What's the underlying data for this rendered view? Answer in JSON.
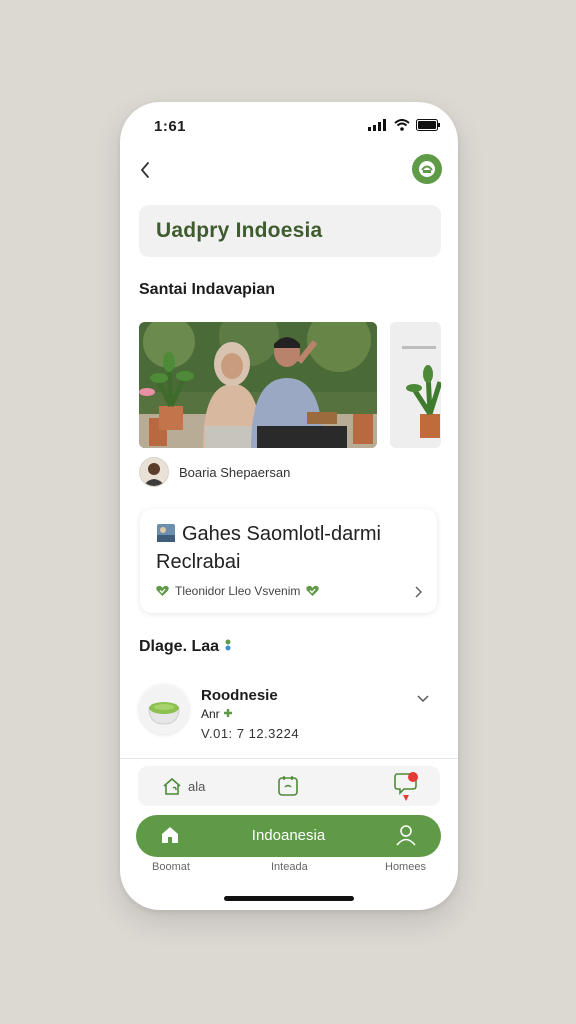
{
  "status_bar": {
    "time": "1:61"
  },
  "header": {
    "search_value": "Uadpry Indoesia"
  },
  "section": {
    "title": "Santai Indavapian",
    "author": "Boaria Shepaersan"
  },
  "card": {
    "title": "Gahes Saomlotl-darmi Reclrabai",
    "tag_text": "Tleonidor Lleo Vsvenim"
  },
  "list": {
    "title": "Dlage. Laa",
    "item": {
      "name": "Roodnesie",
      "sub": "Anr",
      "date": "V.01: 7 12.3224"
    }
  },
  "toolbar": {
    "home_label": "ala"
  },
  "bottom_nav": {
    "label": "Indoanesia",
    "captions": [
      "Boomat",
      "Inteada",
      "Homees"
    ]
  },
  "colors": {
    "accent": "#5f9a46",
    "alert": "#e53935"
  },
  "icons": [
    "back-chevron-icon",
    "profile-icon",
    "home-icon",
    "calendar-icon",
    "chat-alert-icon",
    "user-icon",
    "chevron-right-icon",
    "chevron-down-icon",
    "heart-icon"
  ]
}
